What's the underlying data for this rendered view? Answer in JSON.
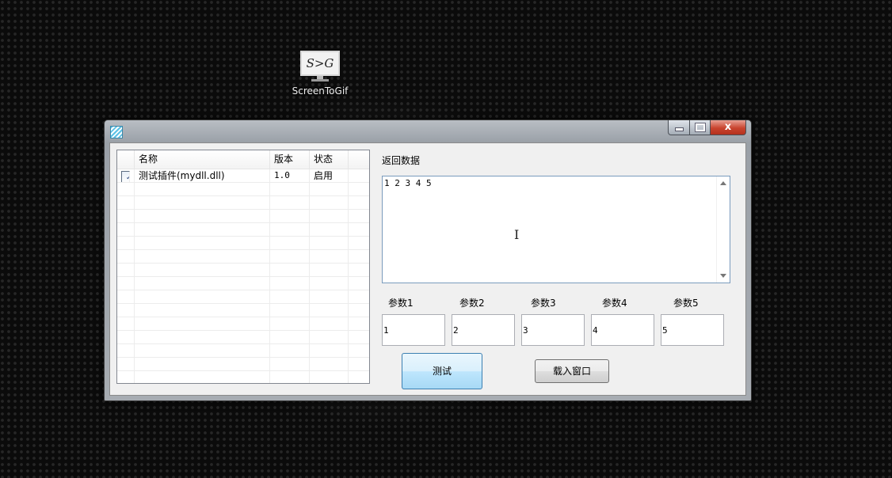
{
  "desktop": {
    "icon": {
      "glyph": "S>G",
      "label": "ScreenToGif"
    }
  },
  "window": {
    "title": "",
    "controls": {
      "minimize": "",
      "maximize": "",
      "close": "x"
    }
  },
  "list": {
    "columns": [
      "",
      "名称",
      "版本",
      "状态",
      ""
    ],
    "rows": [
      {
        "checked": true,
        "name": "测试插件(mydll.dll)",
        "version": "1.0",
        "status": "启用"
      }
    ],
    "empty_rows": 15
  },
  "result": {
    "label": "返回数据",
    "value": "1 2 3 4 5"
  },
  "params": [
    {
      "label": "参数1",
      "value": "1"
    },
    {
      "label": "参数2",
      "value": "2"
    },
    {
      "label": "参数3",
      "value": "3"
    },
    {
      "label": "参数4",
      "value": "4"
    },
    {
      "label": "参数5",
      "value": "5"
    }
  ],
  "buttons": {
    "test": "测试",
    "load_window": "载入窗口"
  },
  "checkmark": "✓",
  "cursor_glyph": "I"
}
